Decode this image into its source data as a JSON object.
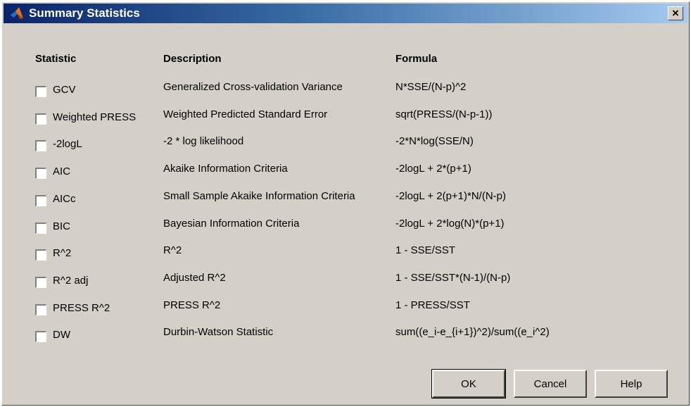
{
  "window": {
    "title": "Summary Statistics",
    "close_label": "×"
  },
  "headers": {
    "statistic": "Statistic",
    "description": "Description",
    "formula": "Formula"
  },
  "rows": [
    {
      "statistic": "GCV",
      "description": "Generalized Cross-validation Variance",
      "formula": "N*SSE/(N-p)^2",
      "checked": false
    },
    {
      "statistic": "Weighted PRESS",
      "description": "Weighted Predicted Standard Error",
      "formula": "sqrt(PRESS/(N-p-1))",
      "checked": false
    },
    {
      "statistic": "-2logL",
      "description": "-2 * log likelihood",
      "formula": "-2*N*log(SSE/N)",
      "checked": false
    },
    {
      "statistic": "AIC",
      "description": "Akaike Information Criteria",
      "formula": "-2logL + 2*(p+1)",
      "checked": false
    },
    {
      "statistic": "AICc",
      "description": "Small Sample Akaike Information Criteria",
      "formula": "-2logL + 2(p+1)*N/(N-p)",
      "checked": false
    },
    {
      "statistic": "BIC",
      "description": "Bayesian Information Criteria",
      "formula": "-2logL + 2*log(N)*(p+1)",
      "checked": false
    },
    {
      "statistic": "R^2",
      "description": "R^2",
      "formula": "1 - SSE/SST",
      "checked": false
    },
    {
      "statistic": "R^2 adj",
      "description": "Adjusted R^2",
      "formula": "1 - SSE/SST*(N-1)/(N-p)",
      "checked": false
    },
    {
      "statistic": "PRESS R^2",
      "description": "PRESS R^2",
      "formula": "1 - PRESS/SST",
      "checked": false
    },
    {
      "statistic": "DW",
      "description": "Durbin-Watson Statistic",
      "formula": "sum((e_i-e_{i+1})^2)/sum((e_i^2)",
      "checked": false
    }
  ],
  "buttons": {
    "ok": "OK",
    "cancel": "Cancel",
    "help": "Help"
  },
  "colors": {
    "dialog_bg": "#d4d0c8",
    "title_start": "#0a246a",
    "title_end": "#a6caf0"
  },
  "icons": {
    "app": "matlab-logo-icon",
    "close": "close-icon"
  }
}
